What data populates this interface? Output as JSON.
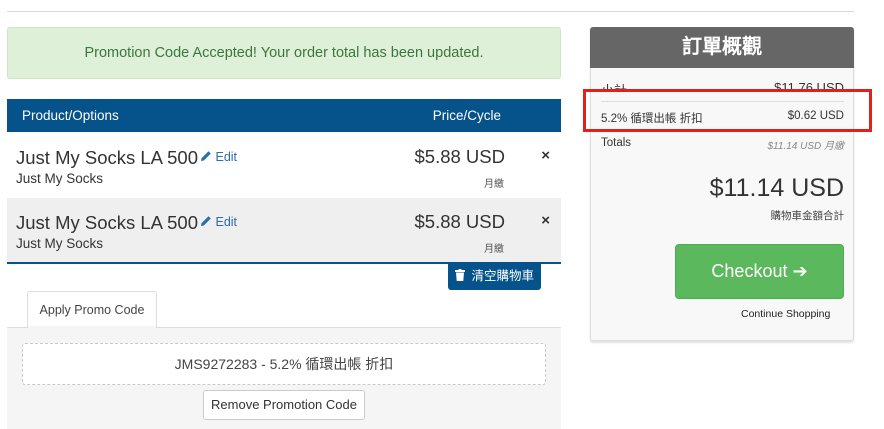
{
  "alert": {
    "message": "Promotion Code Accepted! Your order total has been updated."
  },
  "cart": {
    "header": {
      "product_col": "Product/Options",
      "price_col": "Price/Cycle"
    },
    "items": [
      {
        "name": "Just My Socks LA 500",
        "edit": "Edit",
        "group": "Just My Socks",
        "price": "$5.88 USD",
        "cycle": "月繳",
        "remove": "×"
      },
      {
        "name": "Just My Socks LA 500",
        "edit": "Edit",
        "group": "Just My Socks",
        "price": "$5.88 USD",
        "cycle": "月繳",
        "remove": "×"
      }
    ],
    "empty_cart_label": "清空購物車"
  },
  "promo": {
    "tab_label": "Apply Promo Code",
    "applied_code": "JMS9272283 - 5.2% 循環出帳 折扣",
    "remove_label": "Remove Promotion Code"
  },
  "summary": {
    "title": "訂單概觀",
    "subtotal_label": "小計",
    "subtotal_value": "$11.76 USD",
    "discount_label": "5.2% 循環出帳 折扣",
    "discount_value": "$0.62 USD",
    "totals_label": "Totals",
    "totals_value": "$11.14 USD 月繳",
    "grand_total": "$11.14 USD",
    "grand_total_label": "購物車金額合計",
    "checkout_label": "Checkout",
    "checkout_arrow": "➔",
    "continue_label": "Continue Shopping"
  },
  "colors": {
    "accent": "#05538a",
    "checkout_green": "#5cb85c",
    "alert_bg": "#dff0d8",
    "alert_text": "#3c763d",
    "summary_header": "#666666",
    "highlight": "#e0201b"
  },
  "icons": [
    "pencil-icon",
    "close-icon",
    "trash-icon",
    "arrow-right-icon"
  ]
}
